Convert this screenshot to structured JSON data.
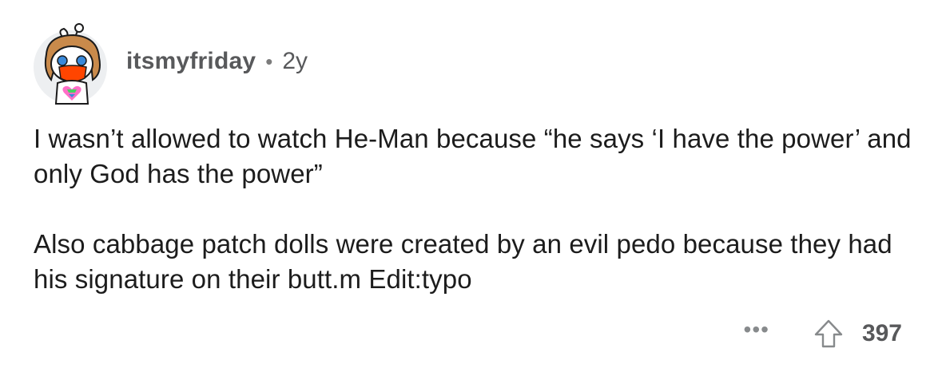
{
  "comment": {
    "username": "itsmyfriday",
    "separator": "•",
    "age": "2y",
    "paragraphs": [
      "I wasn’t allowed to watch He-Man because “he says ‘I have the power’ and only God has the power”",
      "Also cabbage patch dolls were created by an evil pedo because they had his signature on their butt.m Edit:typo"
    ],
    "more_label": "•••",
    "score": "397"
  },
  "icons": {
    "avatar": "snoo-avatar-icon",
    "more": "more-options-icon",
    "upvote": "upvote-arrow-icon"
  },
  "colors": {
    "username": "#58595b",
    "body_text": "#1c1c1c",
    "icon_gray": "#878a8c",
    "avatar_bg": "#edeff1",
    "avatar_hair": "#c98a4b",
    "avatar_mask": "#ff4500"
  }
}
